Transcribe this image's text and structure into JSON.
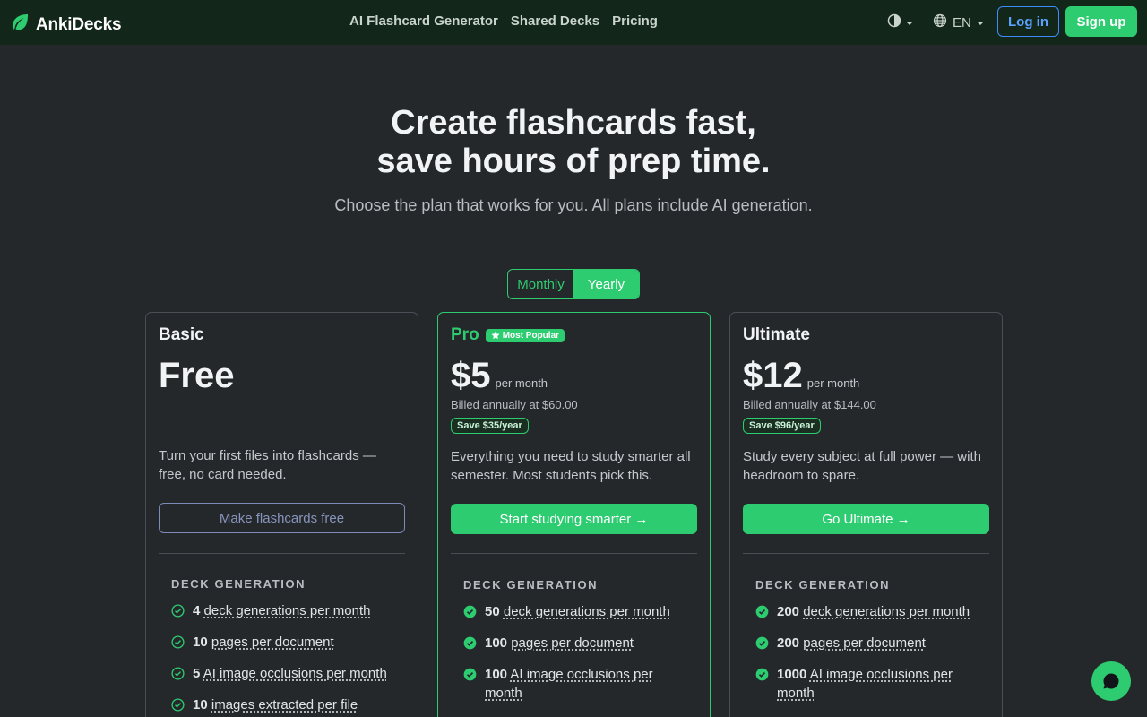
{
  "nav": {
    "brand": "AnkiDecks",
    "links": [
      "AI Flashcard Generator",
      "Shared Decks",
      "Pricing"
    ],
    "language": "EN",
    "login": "Log in",
    "signup": "Sign up"
  },
  "hero": {
    "title_line1": "Create flashcards fast,",
    "title_line2": "save hours of prep time.",
    "subtitle": "Choose the plan that works for you. All plans include AI generation."
  },
  "billing": {
    "options": [
      "Monthly",
      "Yearly"
    ],
    "selected": "Yearly"
  },
  "plans": [
    {
      "name": "Basic",
      "price": "Free",
      "description": "Turn your first files into flashcards — free, no card needed.",
      "cta": "Make flashcards free",
      "section": "DECK GENERATION",
      "features": [
        {
          "num": "4",
          "label": "deck generations per month"
        },
        {
          "num": "10",
          "label": "pages per document"
        },
        {
          "num": "5",
          "label": "AI image occlusions per month"
        },
        {
          "num": "10",
          "label": "images extracted per file"
        }
      ]
    },
    {
      "name": "Pro",
      "badge": "Most Popular",
      "price": "$5",
      "per": "per month",
      "billed": "Billed annually at $60.00",
      "save": "Save $35/year",
      "description": "Everything you need to study smarter all semester. Most students pick this.",
      "cta": "Start studying smarter →",
      "section": "DECK GENERATION",
      "features": [
        {
          "num": "50",
          "label": "deck generations per month"
        },
        {
          "num": "100",
          "label": "pages per document"
        },
        {
          "num": "100",
          "label": "AI image occlusions per month"
        }
      ]
    },
    {
      "name": "Ultimate",
      "price": "$12",
      "per": "per month",
      "billed": "Billed annually at $144.00",
      "save": "Save $96/year",
      "description": "Study every subject at full power — with headroom to spare.",
      "cta": "Go Ultimate →",
      "section": "DECK GENERATION",
      "features": [
        {
          "num": "200",
          "label": "deck generations per month"
        },
        {
          "num": "200",
          "label": "pages per document"
        },
        {
          "num": "1000",
          "label": "AI image occlusions per month"
        }
      ]
    }
  ],
  "icons": {
    "brand": "leaf-icon",
    "theme": "contrast-icon",
    "language": "globe-icon",
    "feature": "check-circle-icon",
    "badge": "star-icon",
    "chat": "chat-bubble-icon"
  },
  "colors": {
    "accent": "#2ecc71",
    "navbar": "#13261a",
    "background": "#25282b",
    "login": "#3d8bfd"
  }
}
